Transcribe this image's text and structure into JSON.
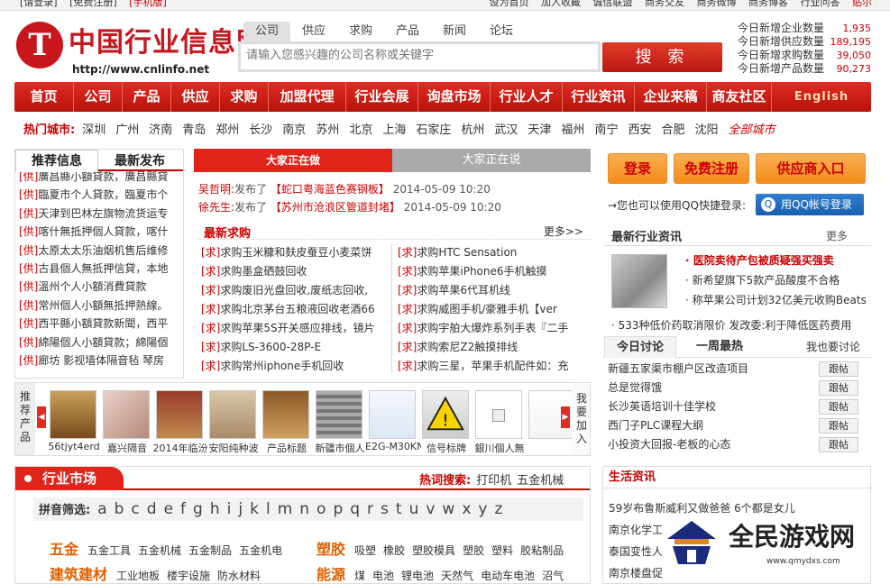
{
  "topbar": {
    "left": [
      "[请登录]",
      "[免费注册]",
      "[手机版]"
    ],
    "right": [
      "设为首页",
      "加入收藏",
      "诚信联盟",
      "商务交友",
      "商务微博",
      "商务博客",
      "行业问答",
      "贴尔"
    ]
  },
  "logo": {
    "mark": "T",
    "text": "中国行业信息网",
    "url": "http://www.cnlinfo.net"
  },
  "search": {
    "tabs": [
      "公司",
      "供应",
      "求购",
      "产品",
      "新闻",
      "论坛"
    ],
    "placeholder": "请输入您感兴趣的公司名称或关键字",
    "button": "搜 索"
  },
  "stats": [
    {
      "label": "今日新增企业数量",
      "value": "1,935"
    },
    {
      "label": "今日新增供应数量",
      "value": "189,195"
    },
    {
      "label": "今日新增求购数量",
      "value": "39,050"
    },
    {
      "label": "今日新增产品数量",
      "value": "90,273"
    }
  ],
  "nav": [
    "首页",
    "公司",
    "产品",
    "供应",
    "求购",
    "加盟代理",
    "行业会展",
    "询盘市场",
    "行业人才",
    "行业资讯",
    "企业来稿",
    "商友社区",
    "English"
  ],
  "cities": {
    "label": "热门城市:",
    "items": [
      "深圳",
      "广州",
      "济南",
      "青岛",
      "郑州",
      "长沙",
      "南京",
      "苏州",
      "北京",
      "上海",
      "石家庄",
      "杭州",
      "武汉",
      "天津",
      "福州",
      "南宁",
      "西安",
      "合肥",
      "沈阳"
    ],
    "all": "全部城市"
  },
  "left_panel": {
    "tabs": [
      "推荐信息",
      "最新发布"
    ],
    "items": [
      {
        "tag": "[供]",
        "text": "廣昌縣小額貸款，廣昌縣貸"
      },
      {
        "tag": "[供]",
        "text": "臨夏市个人貸款，臨夏市个"
      },
      {
        "tag": "[供]",
        "text": "天津到巴林左旗物流货运专"
      },
      {
        "tag": "[供]",
        "text": "喀什無抵押個人貸款，喀什"
      },
      {
        "tag": "[供]",
        "text": "太原太太乐油烟机售后维修"
      },
      {
        "tag": "[供]",
        "text": "古县個人無抵押信貸，本地"
      },
      {
        "tag": "[供]",
        "text": "溫州个人小額消費貸款"
      },
      {
        "tag": "[供]",
        "text": "常州個人小額無抵押熱線。"
      },
      {
        "tag": "[供]",
        "text": "西平縣小額貸款新聞，西平"
      },
      {
        "tag": "[供]",
        "text": "綿陽個人小額貸款；綿陽個"
      },
      {
        "tag": "[供]",
        "text": "廊坊 影视墙体隔音毡 琴房"
      }
    ]
  },
  "mid_tabs": [
    "大家正在做",
    "大家正在说"
  ],
  "mid_feed": [
    {
      "who": "吴哲明:",
      "verb": "发布了",
      "title": "【蛇口粤海蓝色赛钢板】",
      "time": "2014-05-09 10:20"
    },
    {
      "who": "徐先生:",
      "verb": "发布了",
      "title": "【苏州市沧浪区管道封堵】",
      "time": "2014-05-09 10:20"
    }
  ],
  "mid_buy": {
    "title": "最新求购",
    "more": "更多>>",
    "left": [
      {
        "tag": "[求]",
        "text": "求购玉米糠和麸皮蚕豆小麦菜饼"
      },
      {
        "tag": "[求]",
        "text": "求购墨盒硒鼓回收"
      },
      {
        "tag": "[求]",
        "text": "求购废旧光盘回收,废纸志回收,"
      },
      {
        "tag": "[求]",
        "text": "求购北京茅台五粮液回收老酒66"
      },
      {
        "tag": "[求]",
        "text": "求购苹果5S开关感应排线，镜片"
      },
      {
        "tag": "[求]",
        "text": "求购LS-3600-28P-E"
      },
      {
        "tag": "[求]",
        "text": "求购常州iphone手机回收"
      }
    ],
    "right": [
      {
        "tag": "[求]",
        "text": "求购HTC Sensation"
      },
      {
        "tag": "[求]",
        "text": "求购苹果iPhone6手机触摸"
      },
      {
        "tag": "[求]",
        "text": "求购苹果6代耳机线"
      },
      {
        "tag": "[求]",
        "text": "求购威图手机/豪雅手机【ver"
      },
      {
        "tag": "[求]",
        "text": "求购宇舶大爆炸系列手表『二手"
      },
      {
        "tag": "[求]",
        "text": "求购索尼Z2触摸排线"
      },
      {
        "tag": "[求]",
        "text": "求购三星，苹果手机配件如：充"
      }
    ]
  },
  "right": {
    "buttons": [
      "登录",
      "免费注册",
      "供应商入口"
    ],
    "qq_text": "→您也可以使用QQ快捷登录:",
    "qq_button": "用QQ帐号登录",
    "news_title": "最新行业资讯",
    "news_more": "更多",
    "news_items": [
      "· 医院卖待产包被质疑强买强卖",
      "· 新希望旗下5款产品酸度不合格",
      "· 称苹果公司计划32亿美元收购Beats"
    ],
    "news_last": "· 533种低价药取消限价 发改委:利于降低医药费用",
    "discuss_tabs": [
      "今日讨论",
      "一周最热",
      "我也要讨论"
    ],
    "discuss_items": [
      "新疆五家渠市棚户区改造项目",
      "总是觉得饿",
      "长沙英语培训十佳学校",
      "西门子PLC课程大纲",
      "小投资大回报-老板的心态"
    ],
    "discuss_btn": "跟帖"
  },
  "strip": {
    "label": "推荐产品",
    "right_label": "我要加入",
    "captions": [
      "56tjyt4erd",
      "嘉兴隔音",
      "2014年临汾",
      "安阳纯种波",
      "产品标题",
      "新疆市個人",
      "E2G-M30KN1",
      "信号标牌",
      "銀川個人無"
    ]
  },
  "market": {
    "title": "行业市场",
    "hot_label": "热词搜索:",
    "hot_words": [
      "打印机",
      "五金机械"
    ],
    "pinyin_label": "拼音筛选:",
    "letters": [
      "a",
      "b",
      "c",
      "d",
      "e",
      "f",
      "g",
      "h",
      "i",
      "j",
      "k",
      "l",
      "m",
      "n",
      "o",
      "p",
      "q",
      "r",
      "s",
      "t",
      "u",
      "v",
      "w",
      "x",
      "y",
      "z"
    ],
    "rows": [
      {
        "cat": "五金",
        "items": [
          "五金工具",
          "五金机械",
          "五金制品",
          "五金机电"
        ]
      },
      {
        "cat": "塑胶",
        "items": [
          "吸塑",
          "橡胶",
          "塑胶模具",
          "塑胶",
          "塑料",
          "胶粘制品"
        ]
      },
      {
        "cat": "建筑建材",
        "items": [
          "工业地板",
          "楼宇设施",
          "防水材料"
        ]
      },
      {
        "cat": "能源",
        "items": [
          "煤",
          "电池",
          "锂电池",
          "天然气",
          "电动车电池",
          "沼气"
        ]
      }
    ]
  },
  "life": {
    "title": "生活资讯",
    "items": [
      "59岁布鲁斯威利又做爸爸 6个都是女儿",
      "南京化学工",
      "泰国变性人",
      "南京楼盘促"
    ]
  },
  "watermark": {
    "text": "全民游戏网",
    "url": "www.qmydxs.com"
  },
  "colors": {
    "brand": "#c8161d",
    "nav": "#e22b22",
    "orange": "#f38c1b",
    "qq": "#1a5fb0"
  }
}
